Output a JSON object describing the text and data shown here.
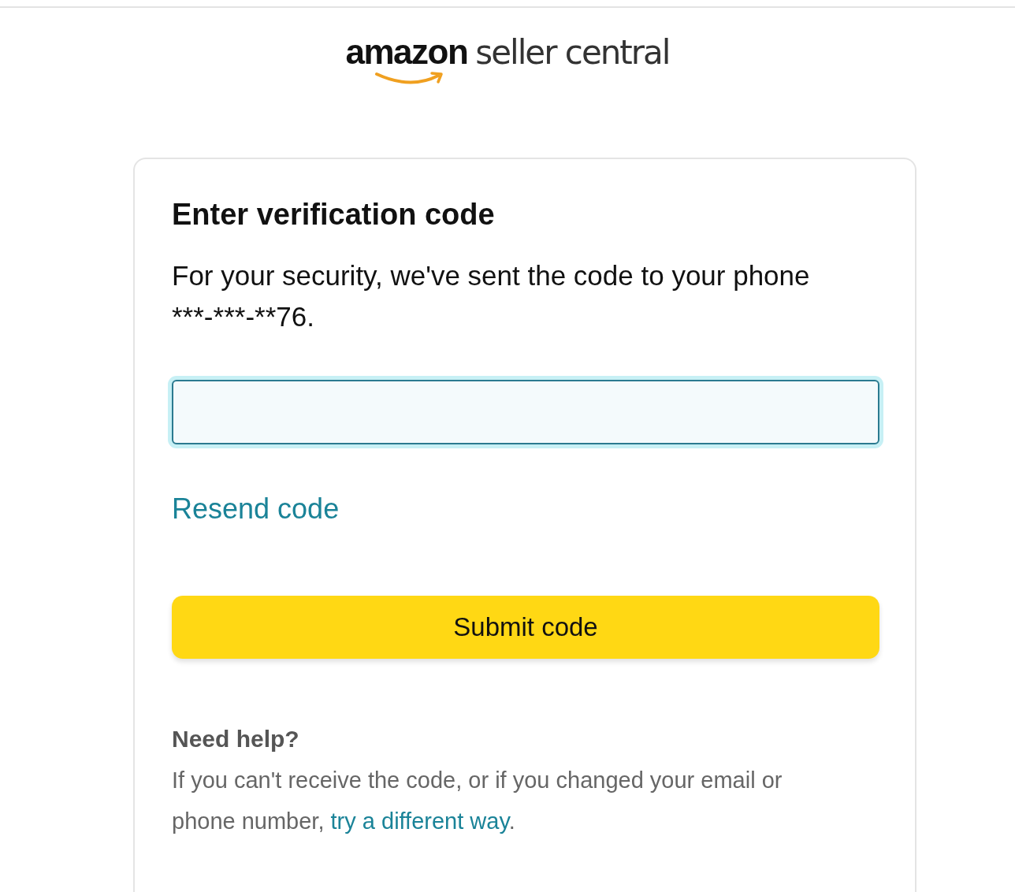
{
  "logo": {
    "brand": "amazon",
    "product": "seller central"
  },
  "card": {
    "title": "Enter verification code",
    "message": "For your security, we've sent the code to your phone ***-***-**76.",
    "code_field": {
      "focused": true
    },
    "resend_link": "Resend code",
    "submit_button": "Submit code",
    "help": {
      "heading": "Need help?",
      "text": "If you can't receive the code, or if you changed your email or phone number, ",
      "link": "try a different way",
      "after": "."
    }
  }
}
